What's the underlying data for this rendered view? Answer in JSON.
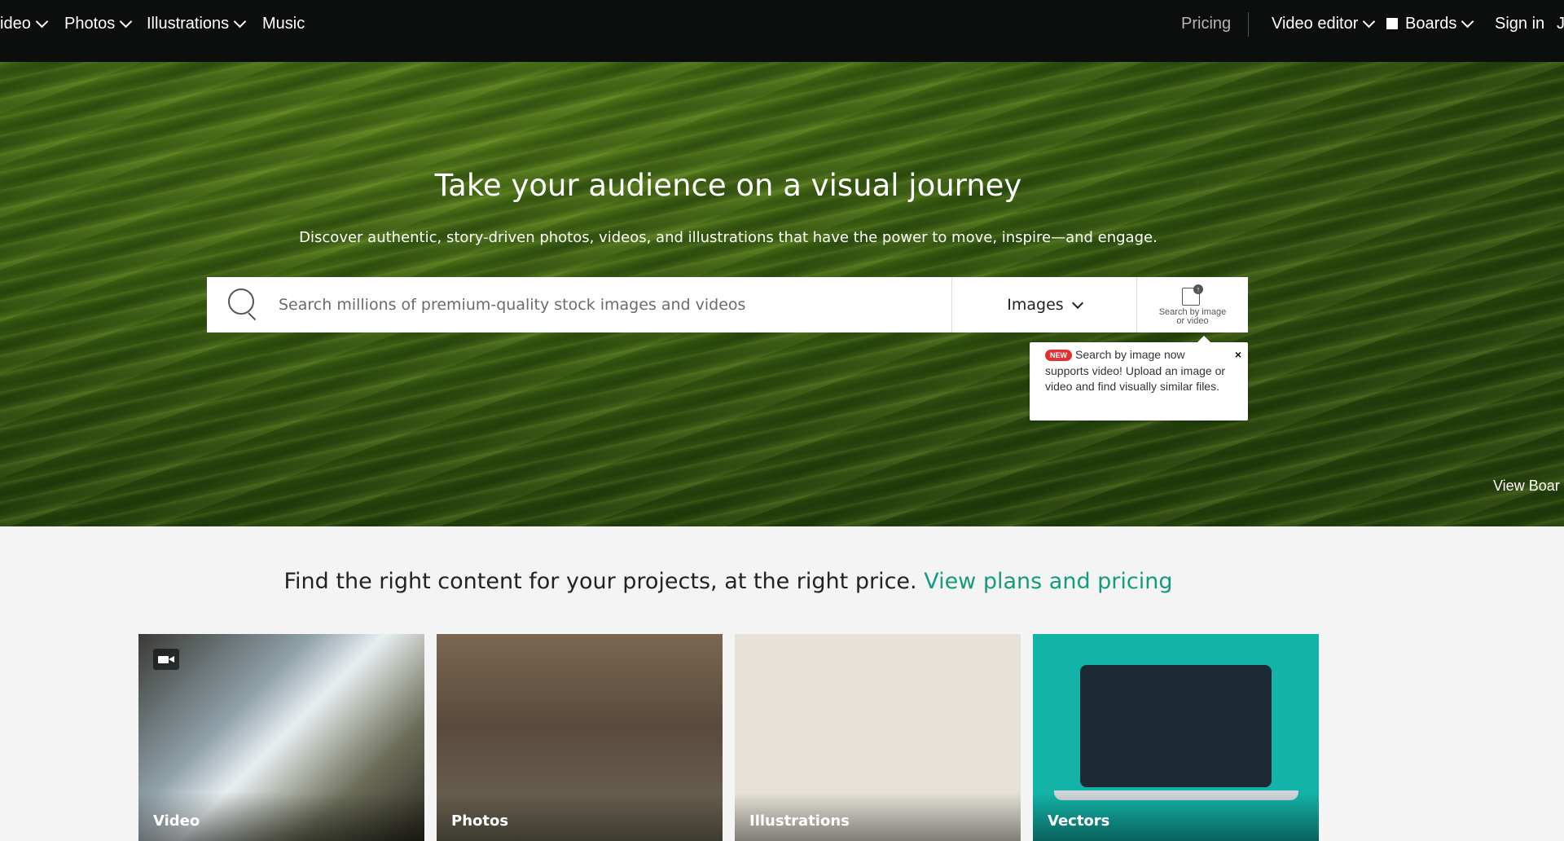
{
  "nav": {
    "left": [
      {
        "label": "ideo",
        "has_chevron": true
      },
      {
        "label": "Photos",
        "has_chevron": true
      },
      {
        "label": "Illustrations",
        "has_chevron": true
      },
      {
        "label": "Music",
        "has_chevron": false
      }
    ],
    "pricing": "Pricing",
    "video_editor": "Video editor",
    "boards": "Boards",
    "sign_in": "Sign in",
    "cut_item": "J"
  },
  "hero": {
    "title": "Take your audience on a visual journey",
    "subtitle": "Discover authentic, story-driven photos, videos, and illustrations that have the power to move, inspire—and engage.",
    "search_placeholder": "Search millions of premium-quality stock images and videos",
    "search_value": "",
    "search_type": "Images",
    "image_search_line1": "Search by image",
    "image_search_line2": "or video",
    "tooltip": {
      "badge": "NEW",
      "text": "Search by image now supports video! Upload an image or video and find visually similar files.",
      "close": "×"
    },
    "view_board": "View Boar"
  },
  "promo": {
    "text": "Find the right content for your projects, at the right price. ",
    "link": "View plans and pricing"
  },
  "tiles": [
    {
      "label": "Video",
      "icon": "video-camera-icon"
    },
    {
      "label": "Photos"
    },
    {
      "label": "Illustrations"
    },
    {
      "label": "Vectors"
    }
  ],
  "colors": {
    "nav_bg": "#0c0d0d",
    "accent_link": "#149b7f",
    "badge_red": "#e4312f",
    "vectors_teal": "#13b3a8"
  }
}
